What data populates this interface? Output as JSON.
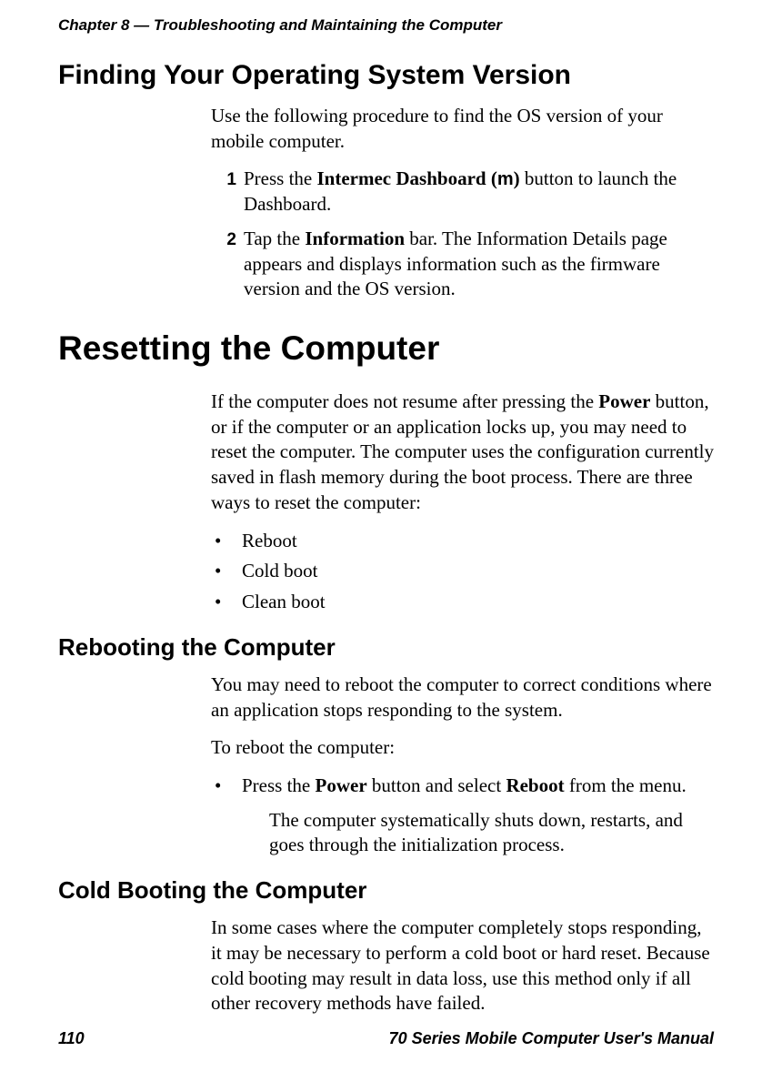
{
  "runningHead": "Chapter 8 — Troubleshooting and Maintaining the Computer",
  "section1": {
    "heading": "Finding Your Operating System Version",
    "intro": "Use the following procedure to find the OS version of your mobile computer.",
    "steps": [
      {
        "num": "1",
        "pre": "Press the ",
        "bold": "Intermec Dashboard (",
        "icon": "m",
        "postBold": ")",
        "post": " button to launch the Dashboard."
      },
      {
        "num": "2",
        "pre": "Tap the ",
        "bold": "Information",
        "post": " bar. The Information Details page appears and displays information such as the firmware version and the OS version."
      }
    ]
  },
  "section2": {
    "heading": "Resetting the Computer",
    "intro_pre": "If the computer does not resume after pressing the ",
    "intro_bold": "Power",
    "intro_post": " button, or if the computer or an application locks up, you may need to reset the computer. The computer uses the configuration currently saved in flash memory during the boot process. There are three ways to reset the computer:",
    "bullets": [
      "Reboot",
      "Cold boot",
      "Clean boot"
    ]
  },
  "section3": {
    "heading": "Rebooting the Computer",
    "p1": "You may need to reboot the computer to correct conditions where an application stops responding to the system.",
    "p2": "To reboot the computer:",
    "bullet_pre": "Press the ",
    "bullet_b1": "Power",
    "bullet_mid": " button and select ",
    "bullet_b2": "Reboot",
    "bullet_post": " from the menu.",
    "sub": "The computer systematically shuts down, restarts, and goes through the initialization process."
  },
  "section4": {
    "heading": "Cold Booting the Computer",
    "p1": "In some cases where the computer completely stops responding, it may be necessary to perform a cold boot or hard reset. Because cold booting may result in data loss, use this method only if all other recovery methods have failed."
  },
  "footer": {
    "pageNum": "110",
    "manual": "70 Series Mobile Computer User's Manual"
  },
  "bulletChar": "•"
}
